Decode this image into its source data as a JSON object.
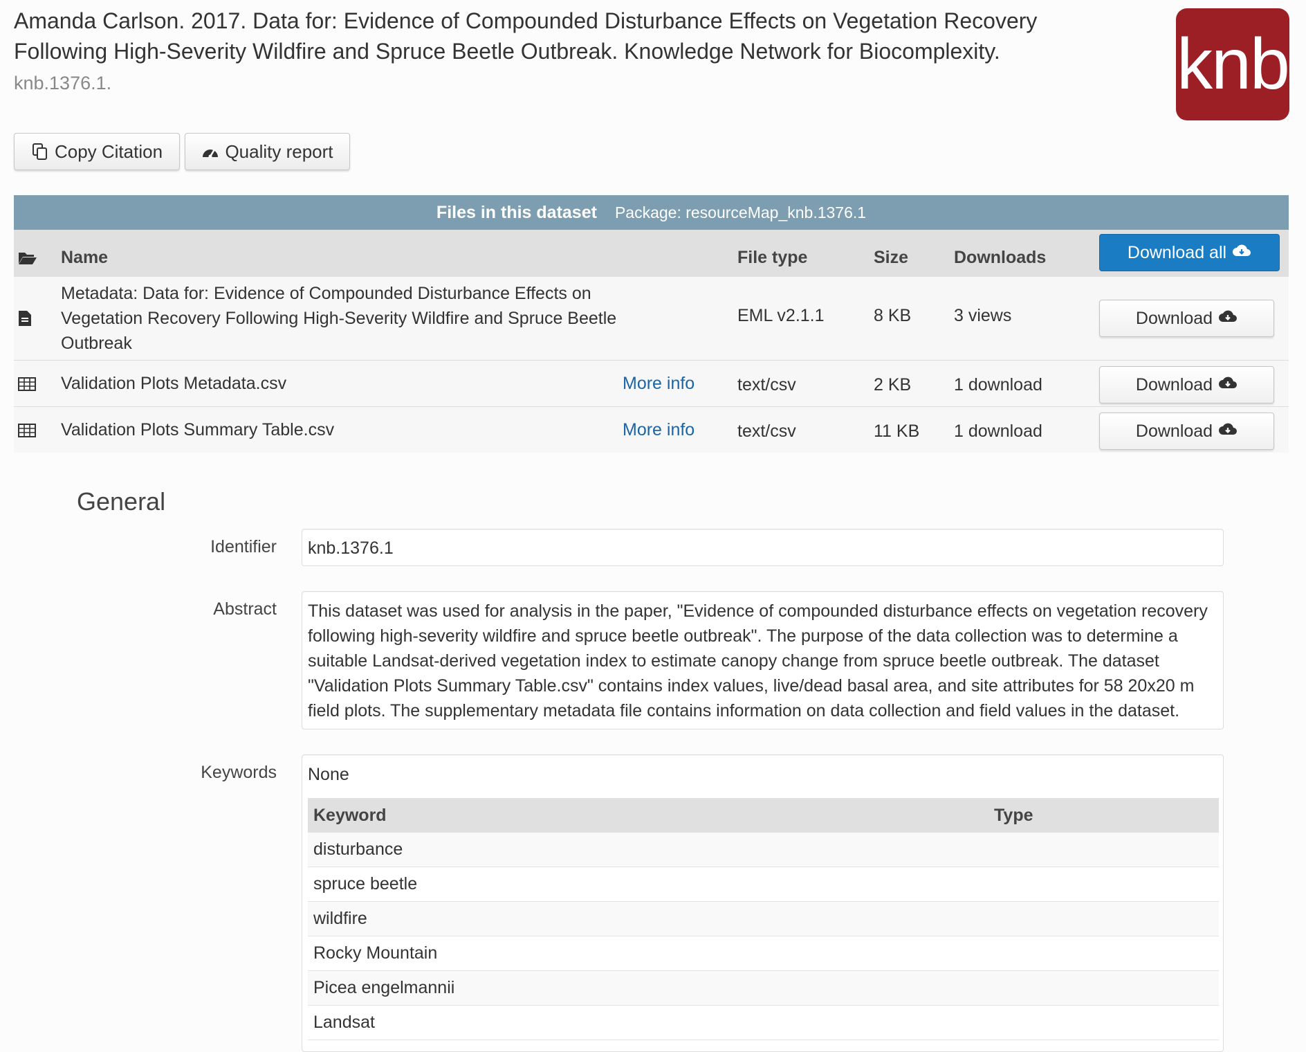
{
  "citation": {
    "text": "Amanda Carlson. 2017. Data for: Evidence of Compounded Disturbance Effects on Vegetation Recovery Following High-Severity Wildfire and Spruce Beetle Outbreak. Knowledge Network for Biocomplexity.",
    "id": "knb.1376.1."
  },
  "logo": {
    "text": "knb",
    "color": "#9b1f25"
  },
  "actions": {
    "copy_citation": "Copy Citation",
    "quality_report": "Quality report"
  },
  "files": {
    "title": "Files in this dataset",
    "package": "Package: resourceMap_knb.1376.1",
    "columns": {
      "name": "Name",
      "file_type": "File type",
      "size": "Size",
      "downloads": "Downloads"
    },
    "download_all": "Download all",
    "rows": [
      {
        "icon": "file-text-icon",
        "name": "Metadata: Data for: Evidence of Compounded Disturbance Effects on Vegetation Recovery Following High-Severity Wildfire and Spruce Beetle Outbreak",
        "more_info": "",
        "file_type": "EML v2.1.1",
        "size": "8 KB",
        "downloads": "3 views",
        "button": "Download"
      },
      {
        "icon": "table-icon",
        "name": "Validation Plots Metadata.csv",
        "more_info": "More info",
        "file_type": "text/csv",
        "size": "2 KB",
        "downloads": "1 download",
        "button": "Download"
      },
      {
        "icon": "table-icon",
        "name": "Validation Plots Summary Table.csv",
        "more_info": "More info",
        "file_type": "text/csv",
        "size": "11 KB",
        "downloads": "1 download",
        "button": "Download"
      }
    ]
  },
  "general": {
    "title": "General",
    "identifier_label": "Identifier",
    "identifier": "knb.1376.1",
    "abstract_label": "Abstract",
    "abstract": "This dataset was used for analysis in the paper, \"Evidence of compounded disturbance effects on vegetation recovery following high-severity wildfire and spruce beetle outbreak\". The purpose of the data collection was to determine a suitable Landsat-derived vegetation index to estimate canopy change from spruce beetle outbreak. The dataset \"Validation Plots Summary Table.csv\" contains index values, live/dead basal area, and site attributes for 58 20x20 m field plots. The supplementary metadata file contains information on data collection and field values in the dataset.",
    "keywords_label": "Keywords",
    "keywords_none": "None",
    "keyword_columns": {
      "keyword": "Keyword",
      "type": "Type"
    },
    "keywords": [
      "disturbance",
      "spruce beetle",
      "wildfire",
      "Rocky Mountain",
      "Picea engelmannii",
      "Landsat"
    ]
  },
  "colors": {
    "header_bar": "#7d9eb0",
    "primary": "#1a7dc4",
    "link": "#1a65a8"
  }
}
